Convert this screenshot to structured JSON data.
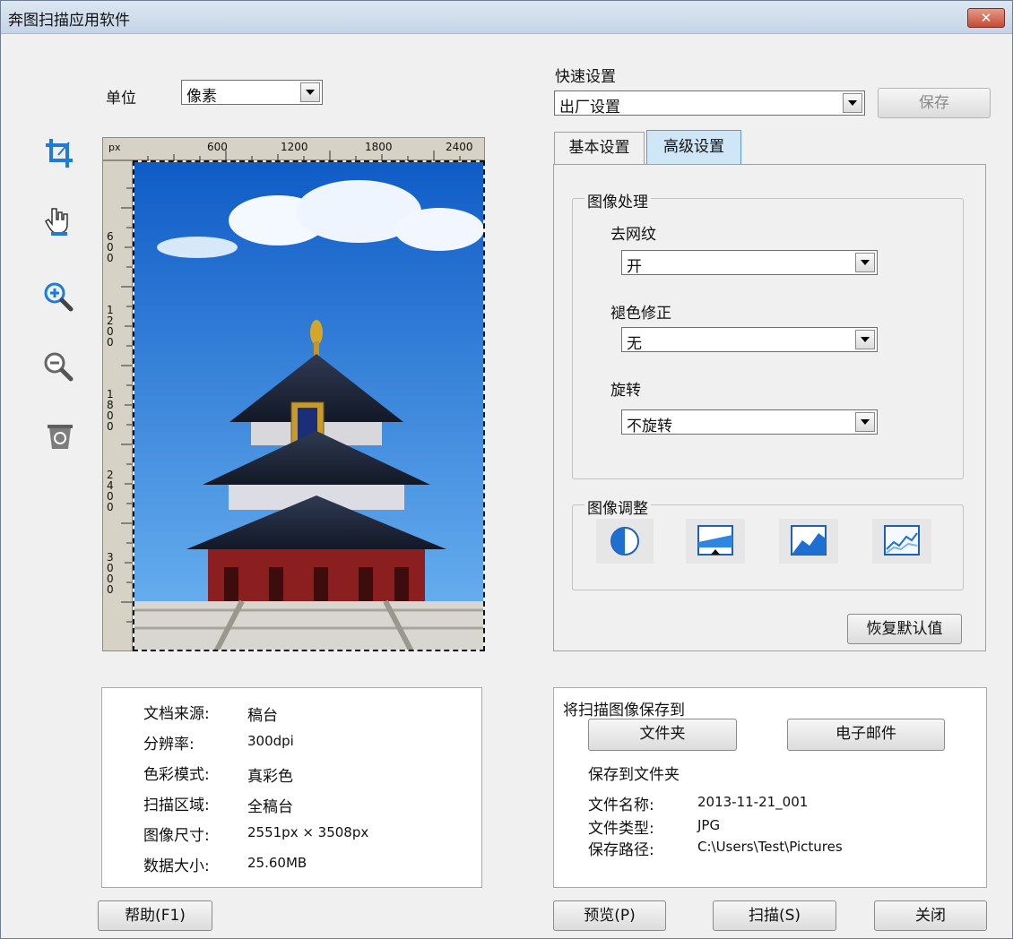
{
  "window": {
    "title": "奔图扫描应用软件",
    "close_glyph": "✕"
  },
  "unit": {
    "label": "单位",
    "value": "像素"
  },
  "ruler": {
    "unit": "px",
    "top_ticks": [
      "600",
      "1200",
      "1800",
      "2400"
    ],
    "left_ticks": [
      "600",
      "1200",
      "1800",
      "2400",
      "3000"
    ]
  },
  "tools": [
    {
      "name": "crop-icon"
    },
    {
      "name": "hand-pan-icon"
    },
    {
      "name": "zoom-in-icon"
    },
    {
      "name": "zoom-out-icon"
    },
    {
      "name": "recycle-bin-icon"
    }
  ],
  "quick": {
    "label": "快速设置",
    "value": "出厂设置",
    "save_label": "保存"
  },
  "tabs": [
    {
      "label": "基本设置",
      "active": false
    },
    {
      "label": "高级设置",
      "active": true
    }
  ],
  "image_processing": {
    "legend": "图像处理",
    "fields": [
      {
        "label": "去网纹",
        "value": "开"
      },
      {
        "label": "褪色修正",
        "value": "无"
      },
      {
        "label": "旋转",
        "value": "不旋转"
      }
    ]
  },
  "image_adjust": {
    "legend": "图像调整",
    "icons": [
      "contrast-icon",
      "levels-icon",
      "tone-curve-icon",
      "histogram-icon"
    ]
  },
  "restore_default_label": "恢复默认值",
  "info": {
    "rows": [
      {
        "label": "文档来源:",
        "value": "稿台"
      },
      {
        "label": "分辨率:",
        "value": "300dpi"
      },
      {
        "label": "色彩模式:",
        "value": "真彩色"
      },
      {
        "label": "扫描区域:",
        "value": "全稿台"
      },
      {
        "label": "图像尺寸:",
        "value": "2551px × 3508px"
      },
      {
        "label": "数据大小:",
        "value": "25.60MB"
      }
    ]
  },
  "save_to": {
    "title": "将扫描图像保存到",
    "folder_label": "文件夹",
    "email_label": "电子邮件",
    "sub_title": "保存到文件夹",
    "rows": [
      {
        "label": "文件名称:",
        "value": "2013-11-21_001"
      },
      {
        "label": "文件类型:",
        "value": "JPG"
      },
      {
        "label": "保存路径:",
        "value": "C:\\Users\\Test\\Pictures"
      }
    ]
  },
  "footer": {
    "help_label": "帮助(F1)",
    "preview_label": "预览(P)",
    "scan_label": "扫描(S)",
    "close_label": "关闭"
  },
  "colors": {
    "accent": "#1f7bd6",
    "tab_active": "#cfe6f7",
    "sky": "#2f79d8"
  }
}
